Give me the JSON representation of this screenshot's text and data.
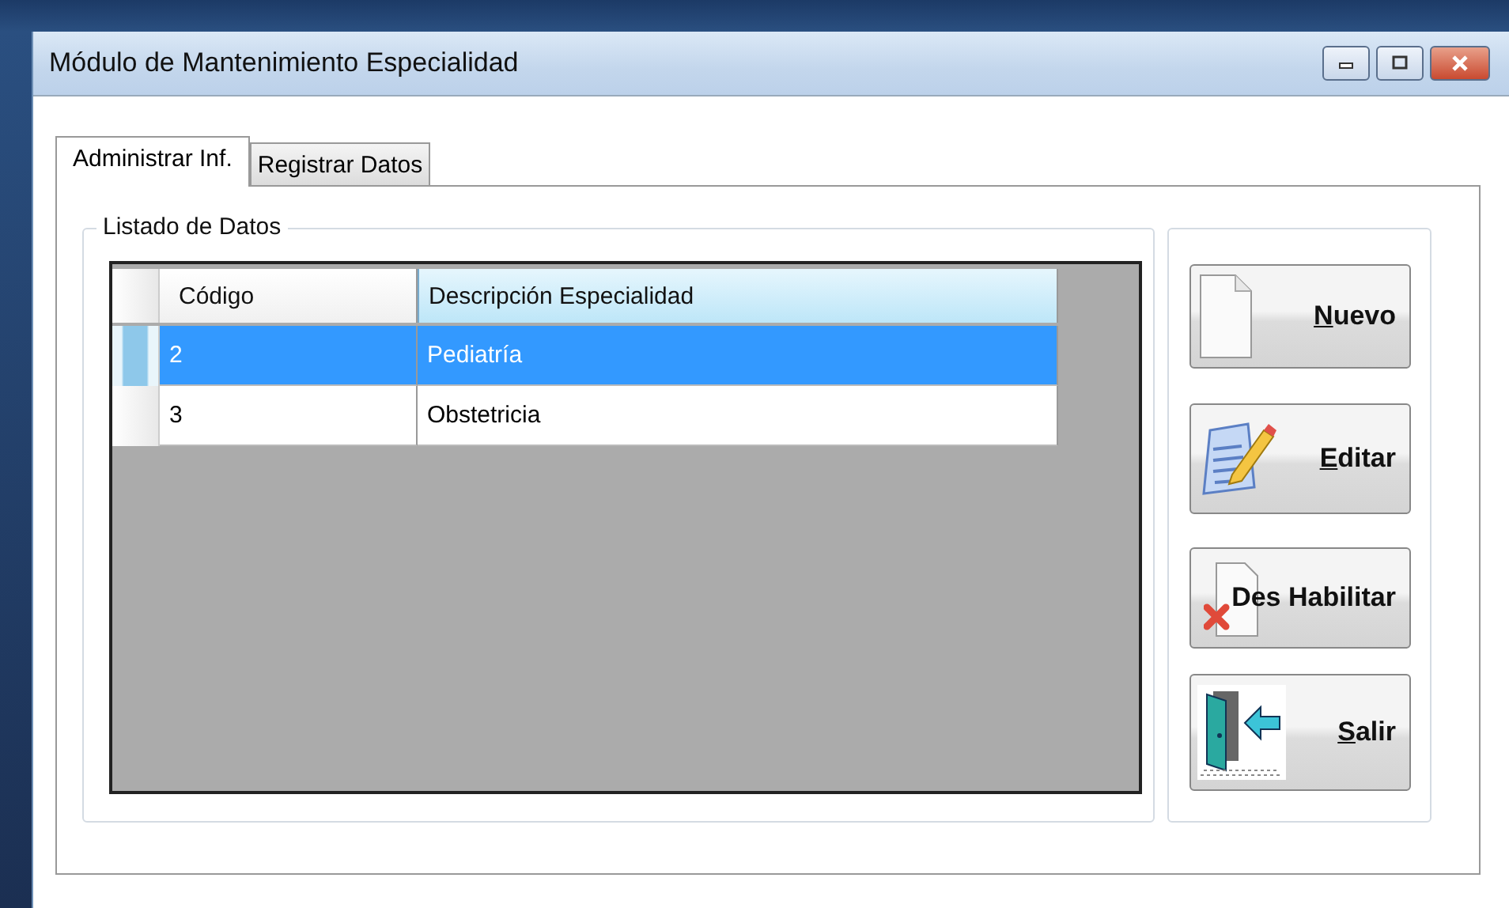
{
  "window": {
    "title": "Módulo de Mantenimiento Especialidad"
  },
  "tabs": [
    {
      "label": "Administrar Inf.",
      "selected": true
    },
    {
      "label": "Registrar Datos",
      "selected": false
    }
  ],
  "group": {
    "title": "Listado de Datos"
  },
  "table": {
    "columns": [
      "Código",
      "Descripción Especialidad"
    ],
    "rows": [
      {
        "cells": [
          "2",
          "Pediatría"
        ],
        "selected": true
      },
      {
        "cells": [
          "3",
          "Obstetricia"
        ],
        "selected": false
      }
    ]
  },
  "buttons": [
    {
      "kind": "new",
      "label": "Nuevo",
      "mnemonic": true
    },
    {
      "kind": "edit",
      "label": "Editar",
      "mnemonic": true
    },
    {
      "kind": "disable",
      "label": "Des Habilitar",
      "mnemonic": false
    },
    {
      "kind": "exit",
      "label": "Salir",
      "mnemonic": true
    }
  ]
}
